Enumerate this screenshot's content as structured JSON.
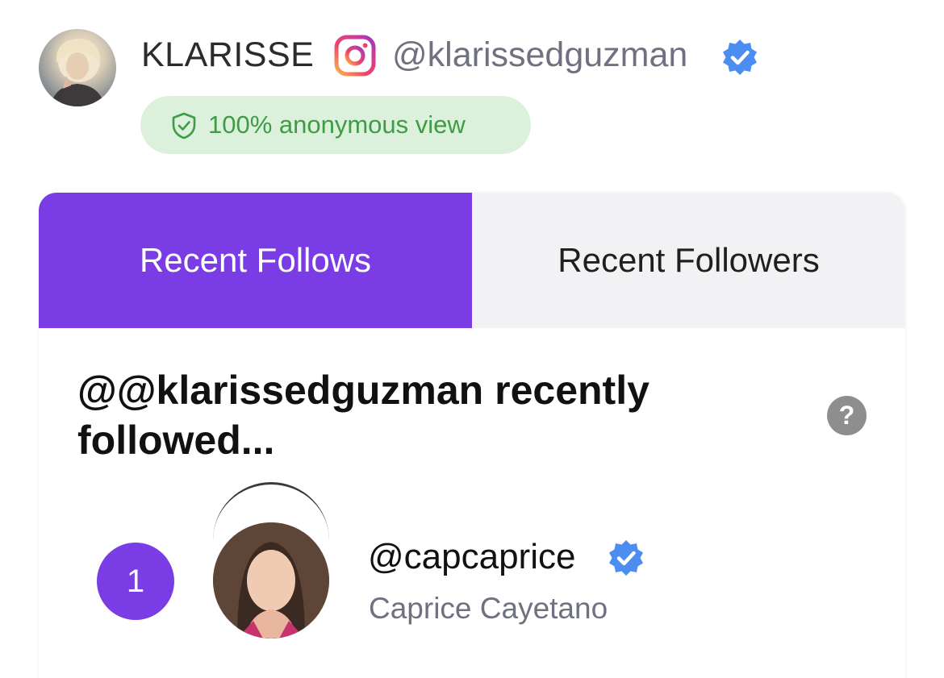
{
  "profile": {
    "name": "KLARISSE",
    "handle": "@klarissedguzman",
    "verified_icon": "verified-badge-icon",
    "platform_icon": "instagram-icon",
    "anonymous_badge": "100% anonymous view"
  },
  "tabs": [
    {
      "label": "Recent Follows",
      "active": true
    },
    {
      "label": "Recent Followers",
      "active": false
    }
  ],
  "section": {
    "heading": "@@klarissedguzman recently followed...",
    "help_icon": "?"
  },
  "list": [
    {
      "rank": "1",
      "username": "@capcaprice",
      "full_name": "Caprice Cayetano",
      "verified": true
    }
  ],
  "colors": {
    "accent": "#7a3de5",
    "verified": "#4b8df0",
    "badge_bg": "#dcf1dc",
    "badge_text": "#3f9b45"
  }
}
